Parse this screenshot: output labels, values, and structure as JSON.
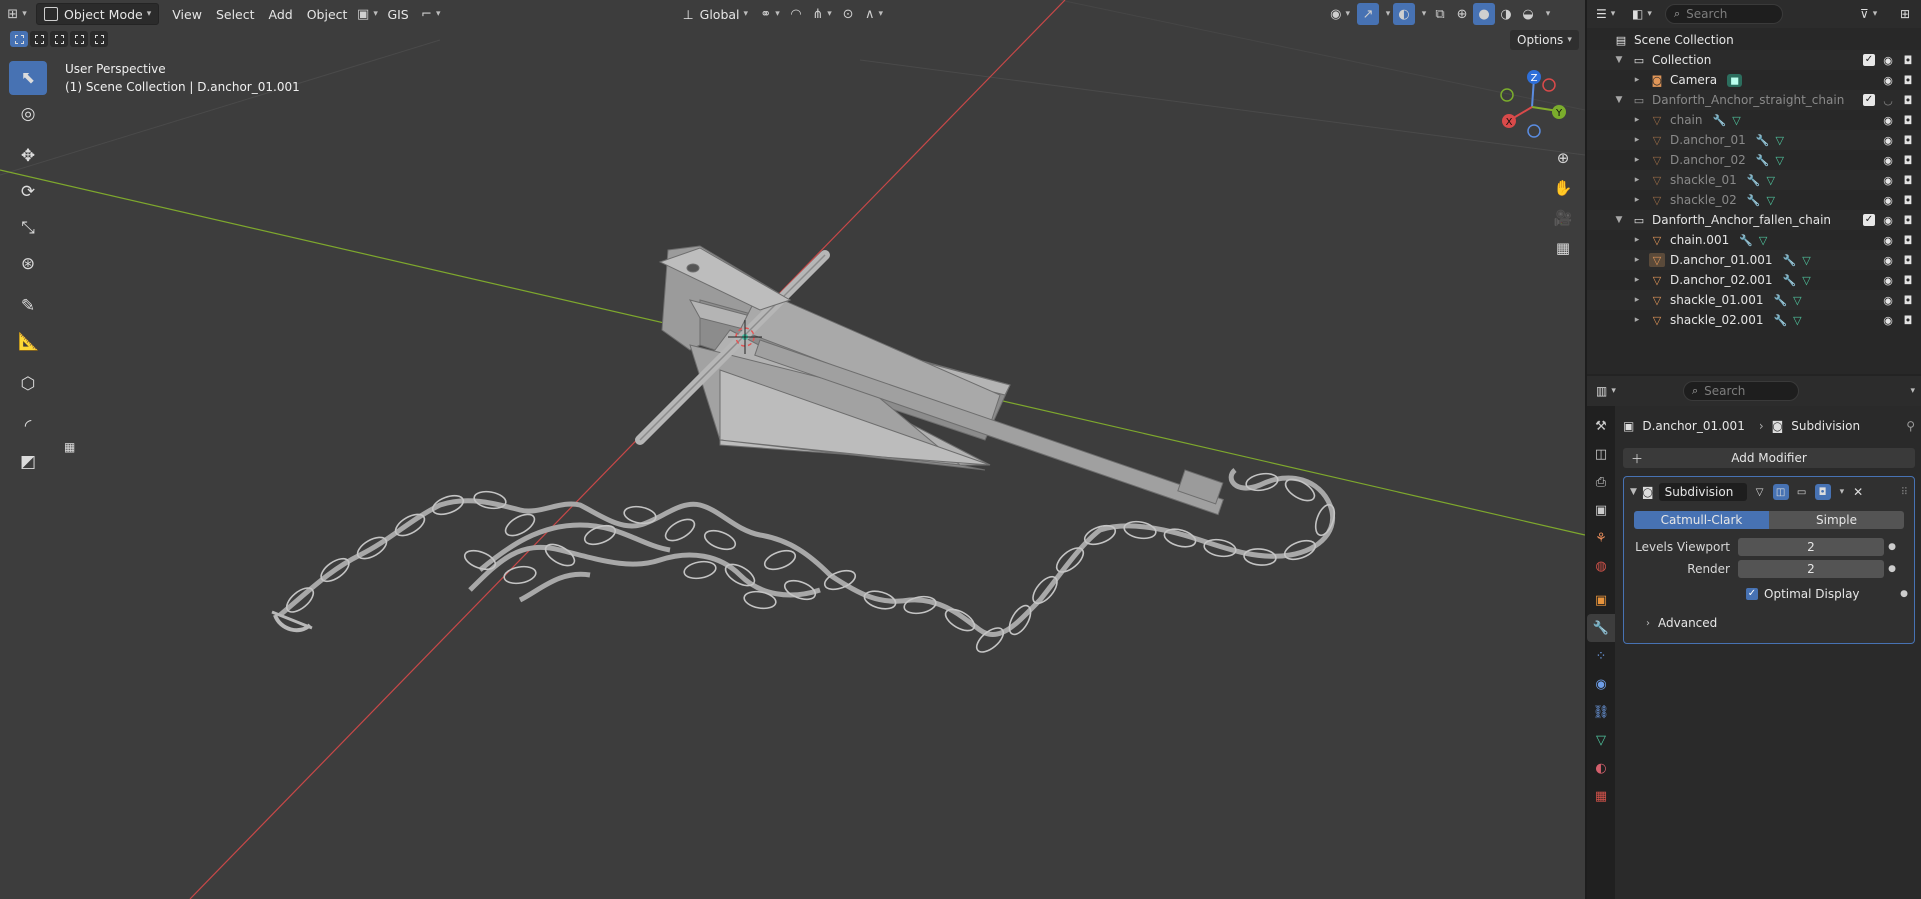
{
  "viewport": {
    "header": {
      "mode": "Object Mode",
      "menus": [
        "View",
        "Select",
        "Add",
        "Object"
      ],
      "gis": "GIS",
      "transform_orientation": "Global",
      "options": "Options"
    },
    "info_line1": "User Perspective",
    "info_line2": "(1) Scene Collection | D.anchor_01.001",
    "gizmo": {
      "z": "Z",
      "y": "Y",
      "x": "X"
    }
  },
  "outliner": {
    "search_placeholder": "Search",
    "rows": [
      {
        "label": "Scene Collection"
      },
      {
        "label": "Collection"
      },
      {
        "label": "Camera"
      },
      {
        "label": "Danforth_Anchor_straight_chain"
      },
      {
        "label": "chain"
      },
      {
        "label": "D.anchor_01"
      },
      {
        "label": "D.anchor_02"
      },
      {
        "label": "shackle_01"
      },
      {
        "label": "shackle_02"
      },
      {
        "label": "Danforth_Anchor_fallen_chain"
      },
      {
        "label": "chain.001"
      },
      {
        "label": "D.anchor_01.001"
      },
      {
        "label": "D.anchor_02.001"
      },
      {
        "label": "shackle_01.001"
      },
      {
        "label": "shackle_02.001"
      }
    ]
  },
  "properties": {
    "search_placeholder": "Search",
    "breadcrumb_object": "D.anchor_01.001",
    "breadcrumb_modifier": "Subdivision",
    "add_modifier": "Add Modifier",
    "modifier": {
      "name": "Subdivision",
      "method_selected": "Catmull-Clark",
      "method_other": "Simple",
      "levels_viewport_label": "Levels Viewport",
      "levels_viewport": "2",
      "render_label": "Render",
      "render": "2",
      "optimal_display": "Optimal Display",
      "advanced": "Advanced"
    }
  },
  "colors": {
    "accent": "#4772b3",
    "x_axis": "#d94a4a",
    "y_axis": "#83ad2c",
    "mesh_icon": "#e19658",
    "modifier_icon": "#6e9ee8",
    "data_icon": "#50c69f"
  }
}
